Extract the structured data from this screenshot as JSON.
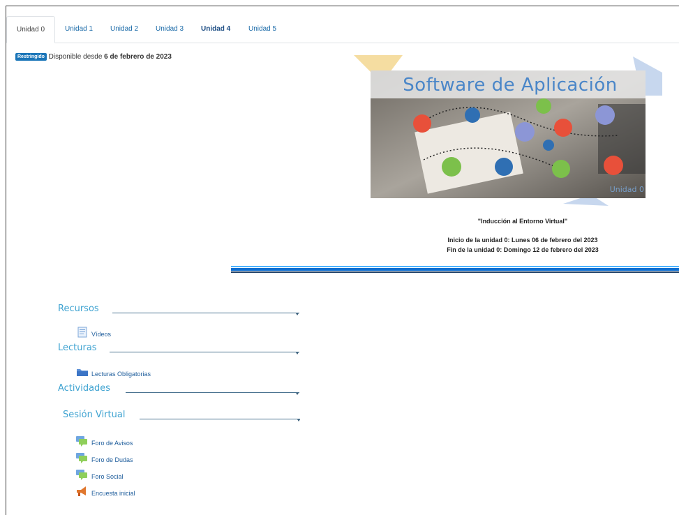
{
  "tabs": [
    {
      "label": "Unidad 0",
      "active": true
    },
    {
      "label": "Unidad 1"
    },
    {
      "label": "Unidad 2"
    },
    {
      "label": "Unidad 3"
    },
    {
      "label": "Unidad 4",
      "bold": true
    },
    {
      "label": "Unidad 5"
    }
  ],
  "restriction": {
    "badge": "Restringido",
    "text": "Disponible desde",
    "date": "6 de febrero de 2023"
  },
  "banner": {
    "title": "Software de Aplicación",
    "unit_label": "Unidad 0"
  },
  "info": {
    "quote": "\"Inducción al Entorno Virtual\"",
    "start": "Inicio de la unidad 0: Lunes 06 de febrero del 2023",
    "end": "Fin de la unidad 0: Domingo 12  de febrero  del 2023"
  },
  "sections": {
    "recursos": {
      "title": "Recursos",
      "items": [
        {
          "label": "Vídeos",
          "icon": "page-icon"
        }
      ]
    },
    "lecturas": {
      "title": "Lecturas",
      "items": [
        {
          "label": "Lecturas Obligatorias",
          "icon": "folder-icon"
        }
      ]
    },
    "actividades": {
      "title": "Actividades"
    },
    "sesion": {
      "title": "Sesión Virtual",
      "items": [
        {
          "label": "Foro de Avisos",
          "icon": "forum-icon"
        },
        {
          "label": "Foro de Dudas",
          "icon": "forum-icon"
        },
        {
          "label": "Foro Social",
          "icon": "forum-icon"
        },
        {
          "label": "Encuesta inicial",
          "icon": "megaphone-icon"
        }
      ]
    }
  },
  "colors": {
    "tab_link": "#1a6aa8",
    "badge": "#1a75b8",
    "section_heading": "#3fa3d1",
    "divider": "#0d6ed1"
  }
}
